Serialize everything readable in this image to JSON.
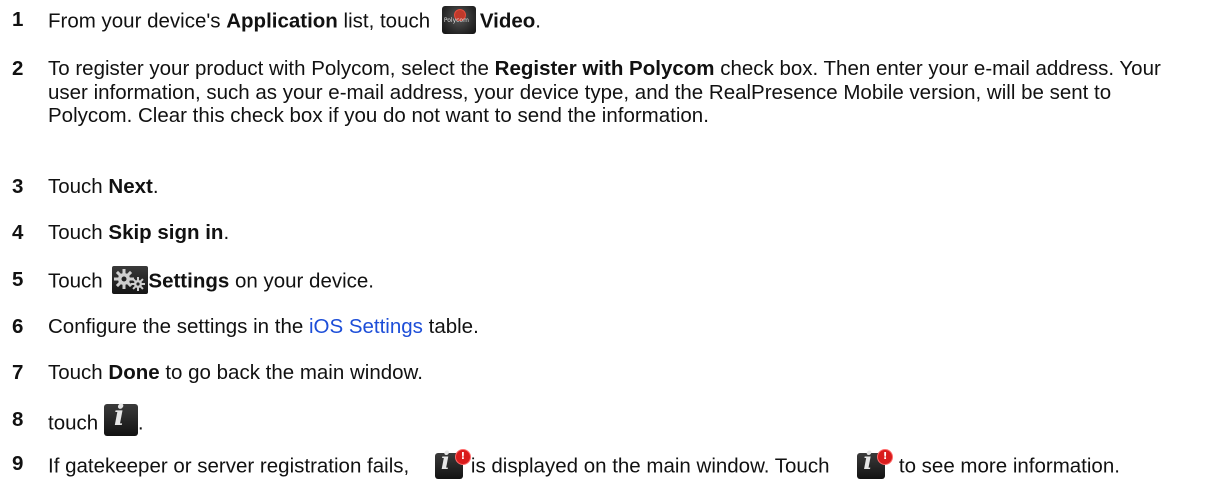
{
  "steps": [
    {
      "number": "1",
      "t1": "From your device's ",
      "b1": "Application",
      "t2": " list, touch ",
      "b2": "Video",
      "t3": "."
    },
    {
      "number": "2",
      "t1": "To register your product with Polycom, select the ",
      "b1": "Register with Polycom",
      "t2": " check box. Then enter your e-mail address. Your user information, such as your e-mail address, your device type, and the RealPresence Mobile version, will be sent to Polycom. Clear this check box if you do not want to send the information."
    },
    {
      "number": "3",
      "t1": "Touch ",
      "b1": "Next",
      "t2": "."
    },
    {
      "number": "4",
      "t1": "Touch ",
      "b1": "Skip sign in",
      "t2": "."
    },
    {
      "number": "5",
      "t1": "Touch ",
      "b1": "Settings",
      "t2": " on your device."
    },
    {
      "number": "6",
      "t1": "Configure the settings in the ",
      "link": "iOS Settings",
      "t2": " table."
    },
    {
      "number": "7",
      "t1": "Touch ",
      "b1": "Done",
      "t2": " to go back the main window."
    },
    {
      "number": "8",
      "t1": "touch ",
      "t2": "."
    },
    {
      "number": "9",
      "t1": "If gatekeeper or server registration fails, ",
      "t2": "is displayed on the main window. Touch ",
      "t3": " to see more information."
    }
  ],
  "icons": {
    "video": "polycom-video-app-icon",
    "video_brand": "Polycom",
    "settings": "gear-icon",
    "info": "info-icon",
    "info_alert": "info-alert-icon",
    "info_glyph": "i",
    "alert_glyph": "!"
  },
  "colors": {
    "link": "#1d4ed8",
    "alert": "#d91c1c"
  }
}
